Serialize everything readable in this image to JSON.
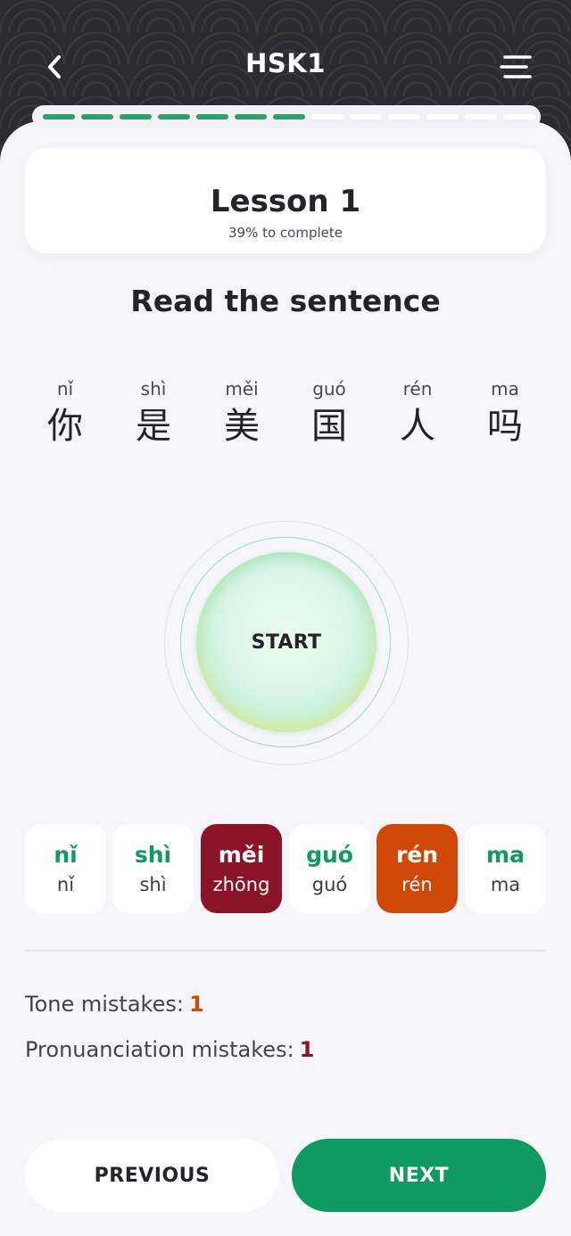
{
  "header": {
    "title": "HSK1",
    "back_icon": "chevron-left-icon",
    "menu_icon": "menu-icon"
  },
  "lesson": {
    "title": "Lesson 1",
    "progress_text": "39% to complete",
    "progress_done_segments": 7,
    "progress_total_segments": 13
  },
  "instruction": "Read the sentence",
  "sentence": [
    {
      "pinyin": "nǐ",
      "hanzi": "你"
    },
    {
      "pinyin": "shì",
      "hanzi": "是"
    },
    {
      "pinyin": "měi",
      "hanzi": "美"
    },
    {
      "pinyin": "guó",
      "hanzi": "国"
    },
    {
      "pinyin": "rén",
      "hanzi": "人"
    },
    {
      "pinyin": "ma",
      "hanzi": "吗"
    }
  ],
  "record_button": {
    "label": "START"
  },
  "results": [
    {
      "expected": "nǐ",
      "heard": "nǐ",
      "status": "correct"
    },
    {
      "expected": "shì",
      "heard": "shì",
      "status": "correct"
    },
    {
      "expected": "měi",
      "heard": "zhōng",
      "status": "pronunciation-mistake"
    },
    {
      "expected": "guó",
      "heard": "guó",
      "status": "correct"
    },
    {
      "expected": "rén",
      "heard": "rén",
      "status": "tone-mistake"
    },
    {
      "expected": "ma",
      "heard": "ma",
      "status": "correct"
    }
  ],
  "stats": {
    "tone_label": "Tone mistakes:",
    "tone_count": "1",
    "pron_label": "Pronuanciation mistakes:",
    "pron_count": "1"
  },
  "buttons": {
    "previous": "PREVIOUS",
    "next": "NEXT"
  },
  "colors": {
    "header_bg": "#2c2b34",
    "accent_green": "#0e9a60",
    "tone_mistake": "#cf4807",
    "pron_mistake": "#8b1428"
  }
}
